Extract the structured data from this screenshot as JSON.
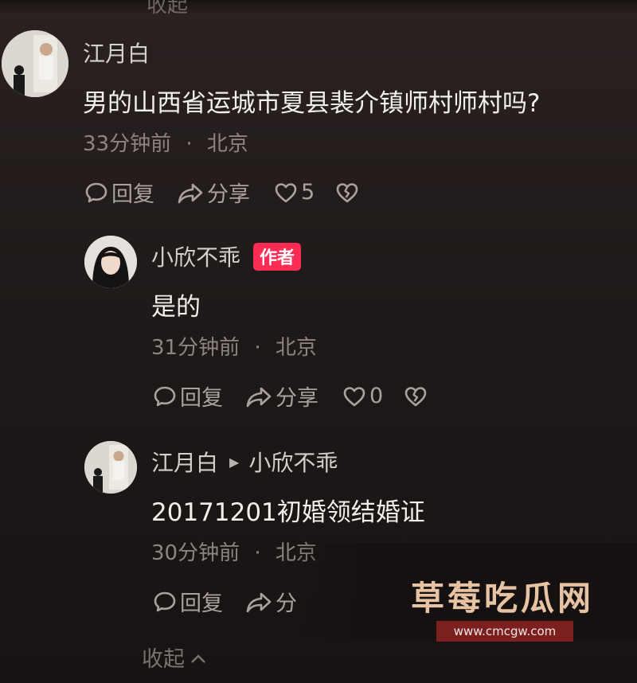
{
  "top_cut_text": "收起",
  "comments": [
    {
      "user": "江月白",
      "text": "男的山西省运城市夏县裴介镇师村师村吗?",
      "time": "33分钟前",
      "location": "北京",
      "actions": {
        "reply": "回复",
        "share": "分享",
        "likes": "5"
      }
    },
    {
      "user": "小欣不乖",
      "badge": "作者",
      "text": "是的",
      "time": "31分钟前",
      "location": "北京",
      "actions": {
        "reply": "回复",
        "share": "分享",
        "likes": "0"
      }
    },
    {
      "user": "江月白",
      "reply_to": "小欣不乖",
      "text": "20171201初婚领结婚证",
      "time": "30分钟前",
      "location": "北京",
      "actions": {
        "reply": "回复",
        "share": "分"
      }
    }
  ],
  "collapse_label": "收起",
  "meta_separator": "·",
  "watermark": {
    "title": "草莓吃瓜网",
    "url": "www.cmcgw.com"
  },
  "colors": {
    "background": "#1f1919",
    "badge": "#fe2c55",
    "watermark_title": "#e7c3a4",
    "watermark_band": "#7b1f1f"
  },
  "icons": [
    "comment-bubble-icon",
    "share-arrow-icon",
    "heart-icon",
    "broken-heart-icon",
    "chevron-up-icon"
  ]
}
